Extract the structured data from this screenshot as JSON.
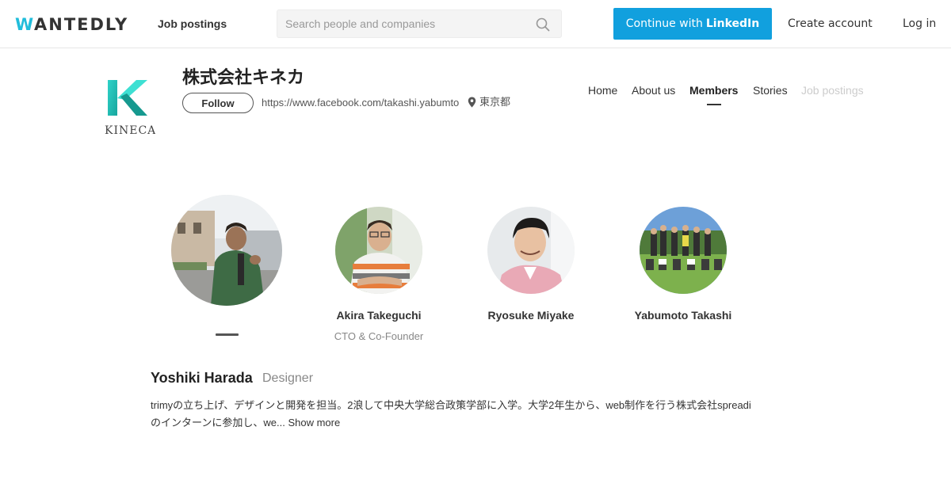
{
  "header": {
    "logo_text": "WANTEDLY",
    "nav_job_postings": "Job postings",
    "search_placeholder": "Search people and companies",
    "linkedin_prefix": "Continue with",
    "linkedin_word": "LinkedIn",
    "create_account": "Create account",
    "login": "Log in"
  },
  "company": {
    "name": "株式会社キネカ",
    "logo_text": "KINECA",
    "follow_label": "Follow",
    "url": "https://www.facebook.com/takashi.yabumto",
    "location": "東京都"
  },
  "tabs": [
    {
      "label": "Home",
      "state": "normal"
    },
    {
      "label": "About us",
      "state": "normal"
    },
    {
      "label": "Members",
      "state": "active"
    },
    {
      "label": "Stories",
      "state": "normal"
    },
    {
      "label": "Job postings",
      "state": "disabled"
    }
  ],
  "members": [
    {
      "name": "",
      "title": "",
      "selected": true
    },
    {
      "name": "Akira Takeguchi",
      "title": "CTO & Co-Founder",
      "selected": false
    },
    {
      "name": "Ryosuke Miyake",
      "title": "",
      "selected": false
    },
    {
      "name": "Yabumoto Takashi",
      "title": "",
      "selected": false
    }
  ],
  "selected_member": {
    "name": "Yoshiki Harada",
    "role": "Designer",
    "bio": "trimyの立ち上げ、デザインと開発を担当。2浪して中央大学総合政策学部に入学。大学2年生から、web制作を行う株式会社spreadiのインターンに参加し、we...",
    "show_more": "Show more"
  },
  "colors": {
    "linkedin_button": "#11a0de",
    "logo_accent": "#1fb7b1"
  }
}
